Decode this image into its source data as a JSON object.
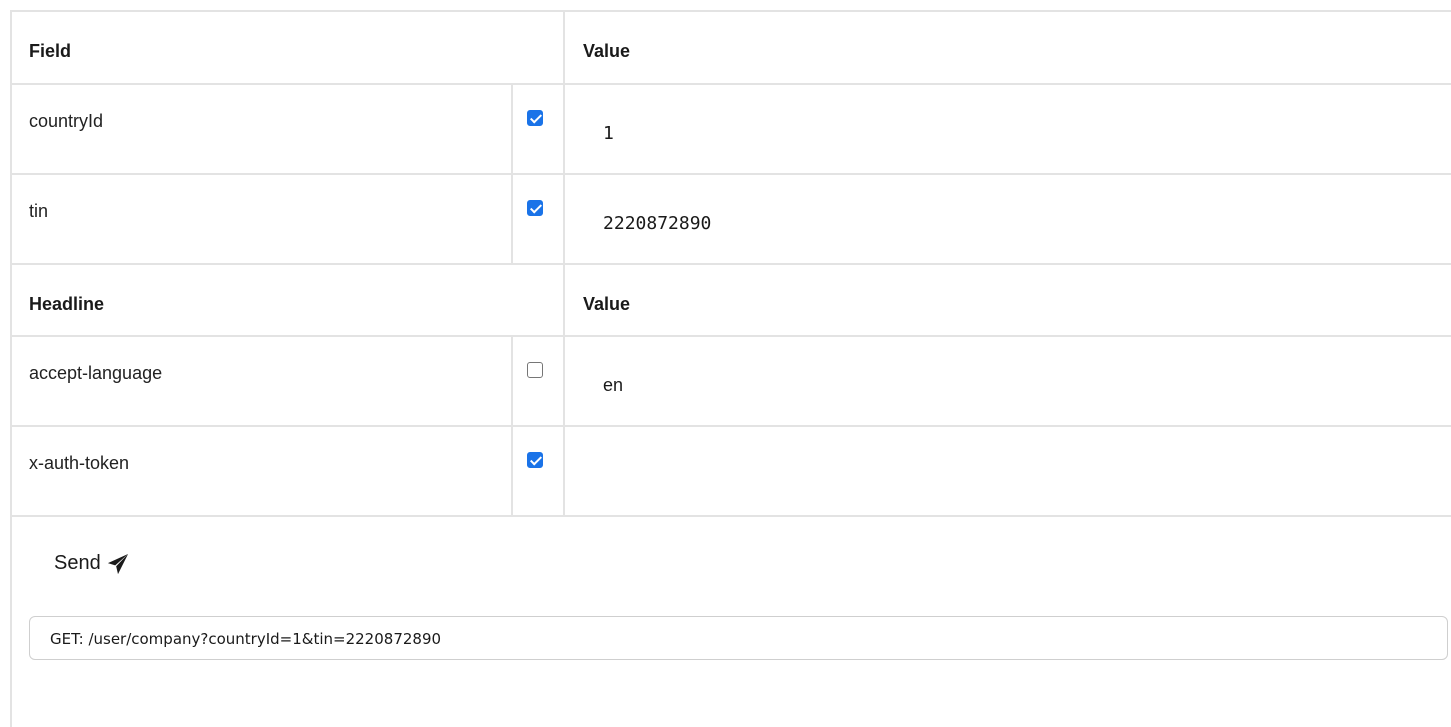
{
  "query_table": {
    "header": {
      "field_label": "Field",
      "value_label": "Value"
    },
    "rows": [
      {
        "name": "countryId",
        "checked": true,
        "value": "1"
      },
      {
        "name": "tin",
        "checked": true,
        "value": "2220872890"
      }
    ]
  },
  "headers_table": {
    "header": {
      "field_label": "Headline",
      "value_label": "Value"
    },
    "rows": [
      {
        "name": "accept-language",
        "checked": false,
        "value": "en"
      },
      {
        "name": "x-auth-token",
        "checked": true,
        "value": ""
      }
    ]
  },
  "send": {
    "label": "Send",
    "icon": "paper-plane-icon"
  },
  "request_url": "GET: /user/company?countryId=1&tin=2220872890",
  "colors": {
    "checkbox_accent": "#1a73e8",
    "border": "#e3e3e3"
  }
}
